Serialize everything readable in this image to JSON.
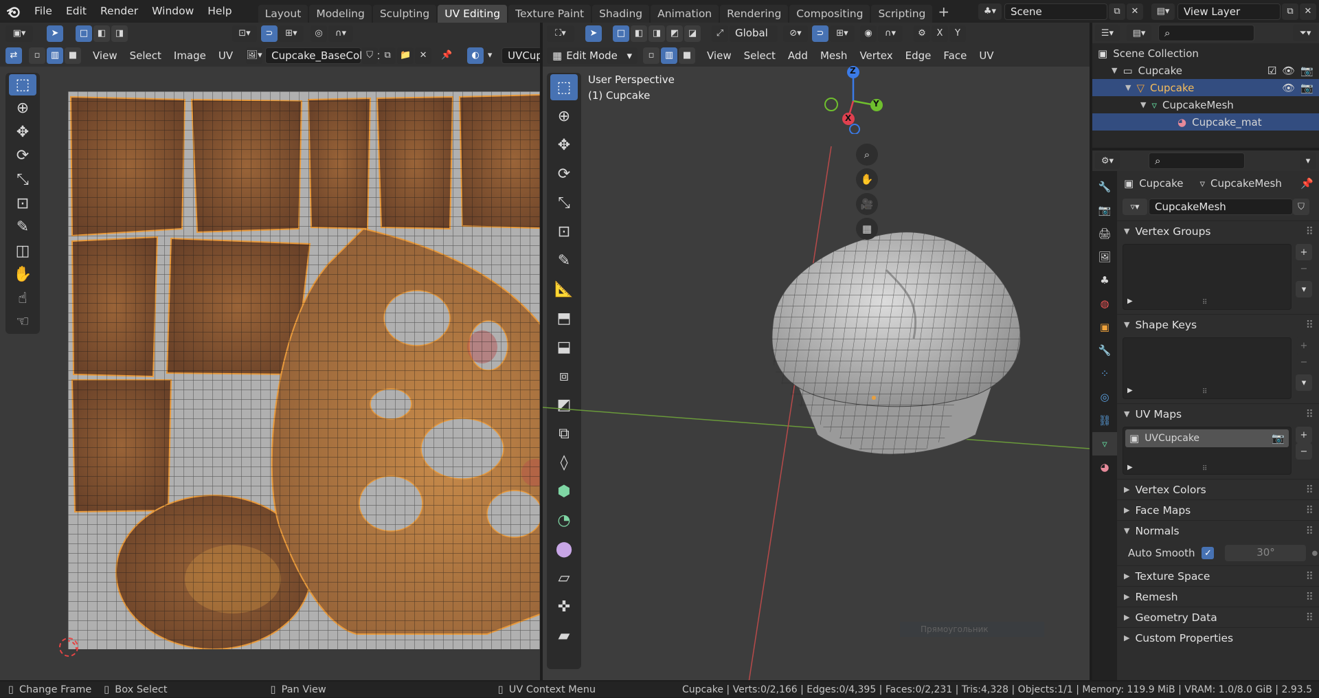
{
  "topbar": {
    "menus": [
      "File",
      "Edit",
      "Render",
      "Window",
      "Help"
    ],
    "workspaces": [
      "Layout",
      "Modeling",
      "Sculpting",
      "UV Editing",
      "Texture Paint",
      "Shading",
      "Animation",
      "Rendering",
      "Compositing",
      "Scripting"
    ],
    "active_workspace": "UV Editing",
    "add_tab": "+",
    "scene": "Scene",
    "view_layer": "View Layer"
  },
  "uv_editor": {
    "header_menus": [
      "View",
      "Select",
      "Image",
      "UV"
    ],
    "image_name": "Cupcake_BaseColor.png",
    "uvmap_name": "UVCupcake"
  },
  "viewport": {
    "orientation": "Global",
    "mode": "Edit Mode",
    "menus": [
      "View",
      "Select",
      "Add",
      "Mesh",
      "Vertex",
      "Edge",
      "Face",
      "UV"
    ],
    "perspective": "User Perspective",
    "object_label": "(1) Cupcake",
    "axes": {
      "x": "X",
      "y": "Y",
      "z": "Z"
    },
    "xyz": [
      "X",
      "Y",
      "Z"
    ]
  },
  "outliner": {
    "title": "Scene Collection",
    "items": [
      {
        "label": "Cupcake"
      },
      {
        "label": "Cupcake"
      },
      {
        "label": "CupcakeMesh"
      },
      {
        "label": "Cupcake_mat"
      }
    ]
  },
  "properties": {
    "breadcrumb_object": "Cupcake",
    "breadcrumb_mesh": "CupcakeMesh",
    "mesh_name": "CupcakeMesh",
    "sections": {
      "vertex_groups": "Vertex Groups",
      "shape_keys": "Shape Keys",
      "uv_maps": "UV Maps",
      "vertex_colors": "Vertex Colors",
      "face_maps": "Face Maps",
      "normals": "Normals",
      "texture_space": "Texture Space",
      "remesh": "Remesh",
      "geometry_data": "Geometry Data",
      "custom_properties": "Custom Properties"
    },
    "uv_map_entry": "UVCupcake",
    "auto_smooth_label": "Auto Smooth",
    "auto_smooth_angle": "30°",
    "tooltip_ghost": "Прямоугольник"
  },
  "statusbar": {
    "change_frame": "Change Frame",
    "box_select": "Box Select",
    "pan_view": "Pan View",
    "uv_context": "UV Context Menu",
    "stats": "Cupcake | Verts:0/2,166 | Edges:0/4,395 | Faces:0/2,231 | Tris:4,328 | Objects:1/1 | Memory: 119.9 MiB | VRAM: 1.0/8.0 GiB | 2.93.5"
  },
  "colors": {
    "accent": "#4772b3",
    "x_axis": "#e0404f",
    "y_axis": "#6fbf2e",
    "z_axis": "#3b7be8",
    "texture_brown": "#8a5a35"
  }
}
